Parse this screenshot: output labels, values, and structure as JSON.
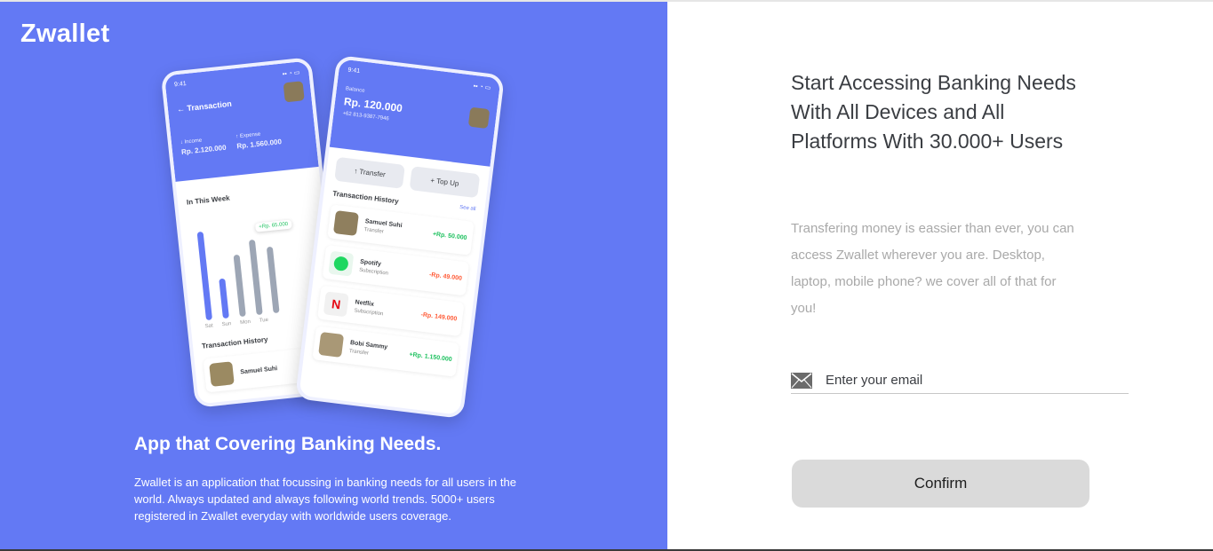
{
  "brand": {
    "name": "Zwallet"
  },
  "hero": {
    "title": "App that Covering Banking Needs.",
    "description": "Zwallet is an application that focussing in banking needs for all users in the world. Always updated and always following world trends. 5000+ users registered in Zwallet everyday with worldwide users coverage."
  },
  "mockup_left": {
    "time": "9:41",
    "title": "Transaction",
    "income_label": "Income",
    "income_value": "Rp. 2.120.000",
    "expense_label": "Expense",
    "expense_value": "Rp. 1.560.000",
    "week_label": "In This Week",
    "tooltip": "+Rp. 65.000",
    "days": [
      "Sat",
      "Sun",
      "Mon",
      "Tue"
    ],
    "history_label": "Transaction History",
    "history_name": "Samuel Suhi"
  },
  "mockup_right": {
    "time": "9:41",
    "balance_label": "Balance",
    "balance": "Rp. 120.000",
    "phone": "+62 813-9387-7946",
    "transfer": "Transfer",
    "topup": "Top Up",
    "history_label": "Transaction History",
    "see_all": "See all",
    "transactions": [
      {
        "name": "Samuel Suhi",
        "type": "Transfer",
        "amount": "+Rp. 50.000"
      },
      {
        "name": "Spotify",
        "type": "Subscription",
        "amount": "-Rp. 49.000"
      },
      {
        "name": "Netflix",
        "type": "Subscription",
        "amount": "-Rp. 149.000"
      },
      {
        "name": "Bobi Sammy",
        "type": "Transfer",
        "amount": "+Rp. 1.150.000"
      }
    ]
  },
  "form": {
    "title": "Start Accessing Banking Needs With All Devices and All Platforms With 30.000+ Users",
    "description": "Transfering money is eassier than ever, you can access Zwallet wherever you are. Desktop, laptop, mobile phone? we cover all of that for you!",
    "email_placeholder": "Enter your email",
    "email_value": "",
    "confirm_label": "Confirm"
  },
  "colors": {
    "primary": "#6379f4",
    "button_bg": "#dadada",
    "positive": "#1ec15f",
    "negative": "#ff5b37"
  }
}
